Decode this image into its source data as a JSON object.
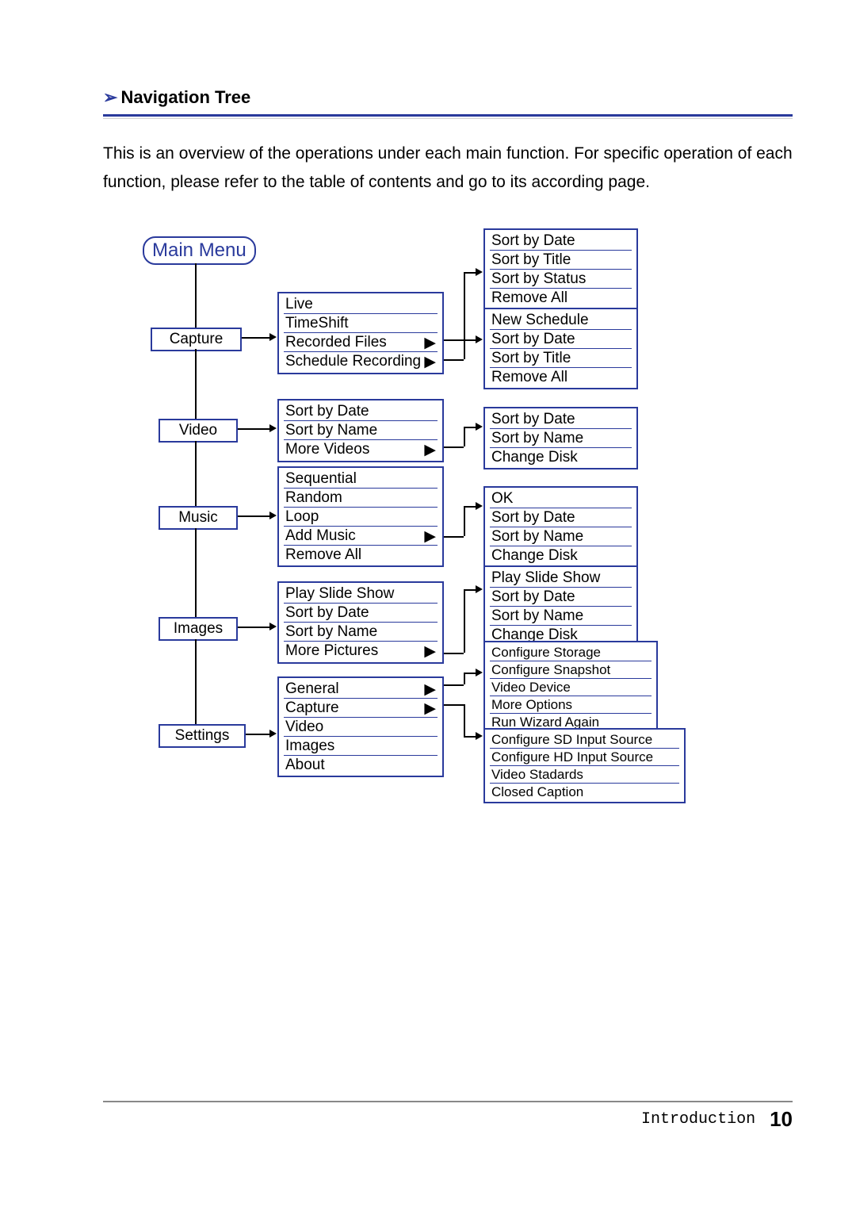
{
  "heading": "Navigation Tree",
  "intro": "This is an overview of the operations under each main function. For specific operation of each function, please refer to the table of contents and go to its according page.",
  "mainMenu": "Main Menu",
  "level1": {
    "capture": "Capture",
    "video": "Video",
    "music": "Music",
    "images": "Images",
    "settings": "Settings"
  },
  "captureSub": [
    "Live",
    "TimeShift",
    "Recorded Files",
    "Schedule Recording"
  ],
  "videoSub": [
    "Sort by Date",
    "Sort by Name",
    "More Videos"
  ],
  "musicSub": [
    "Sequential",
    "Random",
    "Loop",
    "Add Music",
    "Remove All"
  ],
  "imagesSub": [
    "Play Slide Show",
    "Sort by Date",
    "Sort by Name",
    "More Pictures"
  ],
  "settingsSub": [
    "General",
    "Capture",
    "Video",
    "Images",
    "About"
  ],
  "recordedFilesSub": [
    "Sort by Date",
    "Sort by Title",
    "Sort by Status",
    "Remove All"
  ],
  "scheduleSub": [
    "New Schedule",
    "Sort by Date",
    "Sort by Title",
    "Remove All"
  ],
  "moreVideosSub": [
    "Sort by Date",
    "Sort by Name",
    "Change Disk"
  ],
  "addMusicSub": [
    "OK",
    "Sort by Date",
    "Sort by Name",
    "Change Disk"
  ],
  "morePicturesSub": [
    "Play Slide Show",
    "Sort by Date",
    "Sort by Name",
    "Change Disk"
  ],
  "generalSub": [
    "Configure Storage",
    "Configure Snapshot",
    "Video Device",
    "More Options",
    "Run Wizard Again"
  ],
  "captureSettingsSub": [
    "Configure SD Input Source",
    "Configure HD Input Source",
    "Video Stadards",
    "Closed Caption"
  ],
  "footer": {
    "section": "Introduction",
    "page": "10"
  }
}
